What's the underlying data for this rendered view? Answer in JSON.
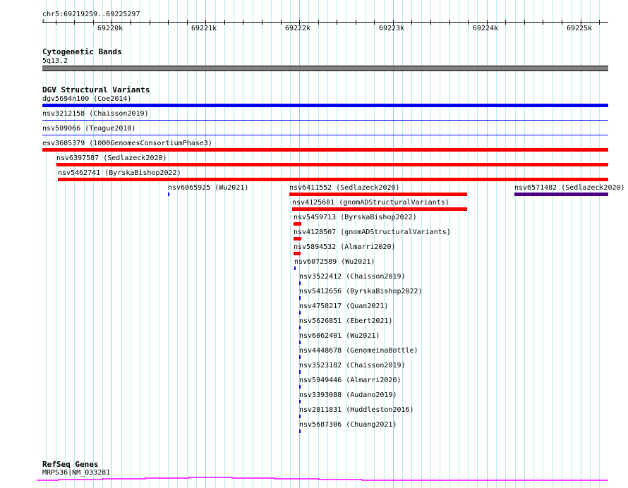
{
  "ruler": {
    "location": "chr5:69219259..69225297",
    "start": 69219259,
    "end": 69225297,
    "labels": [
      "69220k",
      "69221k",
      "69222k",
      "69223k",
      "69224k",
      "69225k"
    ]
  },
  "tracks": {
    "cyto": {
      "title": "Cytogenetic Bands",
      "band": "5q13.2",
      "color": "#808080"
    },
    "dgv": {
      "title": "DGV Structural Variants",
      "features": [
        {
          "label": "dgv5694n100 (Coe2014)",
          "start": 69219259,
          "end": 69225297,
          "row": 0,
          "color": "#0000ff",
          "thick": true
        },
        {
          "label": "nsv3212158 (Chaisson2019)",
          "start": 69219259,
          "end": 69225297,
          "row": 1,
          "color": "#0000ff",
          "thick": false
        },
        {
          "label": "nsv509066 (Teague2010)",
          "start": 69219259,
          "end": 69225297,
          "row": 2,
          "color": "#0000ff",
          "thick": false
        },
        {
          "label": "esv3605379 (1000GenomesConsortiumPhase3)",
          "start": 69219259,
          "end": 69225297,
          "row": 3,
          "color": "#ff0000",
          "thick": true
        },
        {
          "label": "nsv6397587 (Sedlazeck2020)",
          "start": 69219410,
          "end": 69225297,
          "row": 4,
          "color": "#ff0000",
          "thick": true
        },
        {
          "label": "nsv5462741 (ByrskaBishop2022)",
          "start": 69219425,
          "end": 69225297,
          "row": 5,
          "color": "#ff0000",
          "thick": true
        },
        {
          "label": "nsv6065925 (Wu2021)",
          "start": 69220599,
          "end": 69220614,
          "row": 6,
          "color": "#0000ff",
          "thick": true
        },
        {
          "label": "nsv6411552 (Sedlazeck2020)",
          "start": 69221894,
          "end": 69223791,
          "row": 6,
          "color": "#ff0000",
          "thick": true
        },
        {
          "label": "nsv6571482 (Sedlazeck2020)",
          "start": 69224296,
          "end": 69225297,
          "row": 6,
          "color": "#4b0082",
          "thick": true
        },
        {
          "label": "nsv4125601 (gnomADStructuralVariants)",
          "start": 69221924,
          "end": 69223791,
          "row": 7,
          "color": "#ff0000",
          "thick": true
        },
        {
          "label": "nsv5459713 (ByrskaBishop2022)",
          "start": 69221939,
          "end": 69222022,
          "row": 8,
          "color": "#ff0000",
          "thick": true
        },
        {
          "label": "nsv4128507 (gnomADStructuralVariants)",
          "start": 69221939,
          "end": 69222022,
          "row": 9,
          "color": "#ff0000",
          "thick": true
        },
        {
          "label": "nsv5894532 (Almarri2020)",
          "start": 69221939,
          "end": 69222015,
          "row": 10,
          "color": "#ff0000",
          "thick": true
        },
        {
          "label": "nsv6072589 (Wu2021)",
          "start": 69221947,
          "end": 69221962,
          "row": 11,
          "color": "#0000ff",
          "thick": true
        },
        {
          "label": "nsv3522412 (Chaisson2019)",
          "start": 69221999,
          "end": 69222014,
          "row": 12,
          "color": "#0000ff",
          "thick": true
        },
        {
          "label": "nsv5412656 (ByrskaBishop2022)",
          "start": 69221999,
          "end": 69222014,
          "row": 13,
          "color": "#0000ff",
          "thick": true
        },
        {
          "label": "nsv4758217 (Quan2021)",
          "start": 69221999,
          "end": 69222014,
          "row": 14,
          "color": "#0000ff",
          "thick": true
        },
        {
          "label": "nsv5626851 (Ebert2021)",
          "start": 69221999,
          "end": 69222014,
          "row": 15,
          "color": "#0000ff",
          "thick": true
        },
        {
          "label": "nsv6062401 (Wu2021)",
          "start": 69221999,
          "end": 69222014,
          "row": 16,
          "color": "#0000ff",
          "thick": true
        },
        {
          "label": "nsv4448678 (GenomeinaBottle)",
          "start": 69221999,
          "end": 69222014,
          "row": 17,
          "color": "#0000ff",
          "thick": true
        },
        {
          "label": "nsv3523182 (Chaisson2019)",
          "start": 69221999,
          "end": 69222014,
          "row": 18,
          "color": "#0000ff",
          "thick": true
        },
        {
          "label": "nsv5949446 (Almarri2020)",
          "start": 69221999,
          "end": 69222014,
          "row": 19,
          "color": "#0000ff",
          "thick": true
        },
        {
          "label": "nsv3393088 (Audano2019)",
          "start": 69221999,
          "end": 69222014,
          "row": 20,
          "color": "#0000ff",
          "thick": true
        },
        {
          "label": "nsv2811831 (Huddleston2016)",
          "start": 69221999,
          "end": 69222014,
          "row": 21,
          "color": "#0000ff",
          "thick": true
        },
        {
          "label": "nsv5687306 (Chuang2021)",
          "start": 69221999,
          "end": 69222014,
          "row": 22,
          "color": "#0000ff",
          "thick": true
        }
      ]
    },
    "refseq": {
      "title": "RefSeq Genes",
      "gene": "MRPS36|NM_033281",
      "color": "#ff00ff"
    }
  }
}
